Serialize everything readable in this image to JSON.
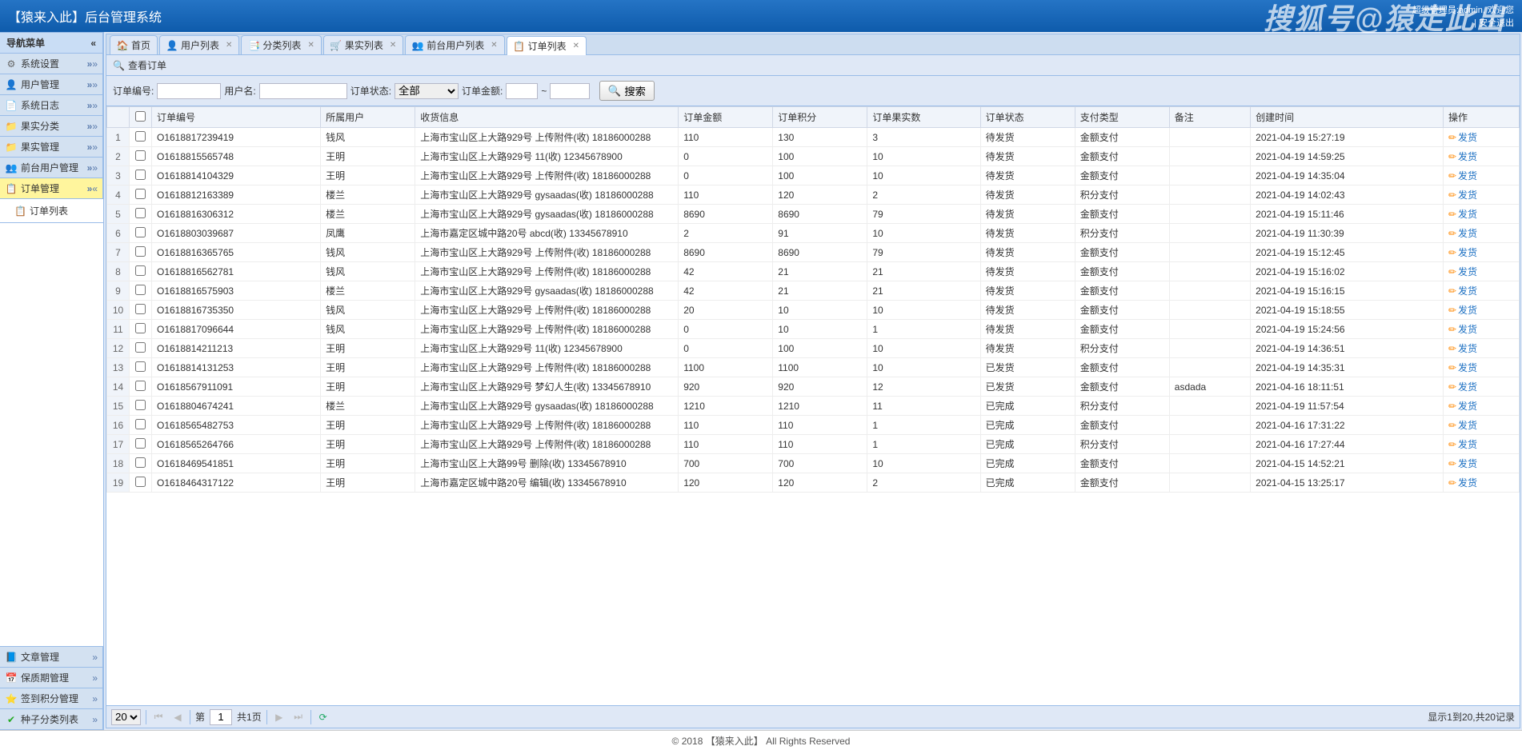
{
  "header": {
    "title": "【猿来入此】后台管理系统",
    "user_line": "超级管理员:admin, 欢迎您",
    "logout": "安全退出",
    "watermark": "搜狐号@猿走此出"
  },
  "sidebar": {
    "title": "导航菜单",
    "top_items": [
      {
        "label": "系统设置",
        "icon": "ico-gear"
      },
      {
        "label": "用户管理",
        "icon": "ico-user"
      },
      {
        "label": "系统日志",
        "icon": "ico-log"
      },
      {
        "label": "果实分类",
        "icon": "ico-folder"
      },
      {
        "label": "果实管理",
        "icon": "ico-folder"
      },
      {
        "label": "前台用户管理",
        "icon": "ico-users"
      },
      {
        "label": "订单管理",
        "icon": "ico-order",
        "active": true
      }
    ],
    "sub": {
      "label": "订单列表",
      "icon": "ico-order"
    },
    "bottom_items": [
      {
        "label": "文章管理",
        "icon": "ico-book"
      },
      {
        "label": "保质期管理",
        "icon": "ico-cal"
      },
      {
        "label": "签到积分管理",
        "icon": "ico-star"
      },
      {
        "label": "种子分类列表",
        "icon": "ico-seed"
      }
    ]
  },
  "tabs": [
    {
      "label": "首页",
      "icon": "ico-home",
      "closable": false
    },
    {
      "label": "用户列表",
      "icon": "ico-user",
      "closable": true
    },
    {
      "label": "分类列表",
      "icon": "ico-cat",
      "closable": true
    },
    {
      "label": "果实列表",
      "icon": "ico-fruit",
      "closable": true
    },
    {
      "label": "前台用户列表",
      "icon": "ico-users",
      "closable": true
    },
    {
      "label": "订单列表",
      "icon": "ico-order",
      "closable": true,
      "active": true
    }
  ],
  "panel_title": "查看订单",
  "search": {
    "order_no_label": "订单编号:",
    "user_label": "用户名:",
    "status_label": "订单状态:",
    "status_value": "全部",
    "amount_label": "订单金额:",
    "amount_sep": "~",
    "btn": "搜索"
  },
  "columns": [
    "",
    "",
    "订单编号",
    "所属用户",
    "收货信息",
    "订单金额",
    "订单积分",
    "订单果实数",
    "订单状态",
    "支付类型",
    "备注",
    "创建时间",
    "操作"
  ],
  "rows": [
    {
      "no": "O1618817239419",
      "user": "钱风",
      "addr": "上海市宝山区上大路929号 上传附件(收) 18186000288",
      "amount": "110",
      "points": "130",
      "qty": "3",
      "status": "待发货",
      "pay": "金额支付",
      "note": "",
      "time": "2021-04-19 15:27:19"
    },
    {
      "no": "O1618815565748",
      "user": "王明",
      "addr": "上海市宝山区上大路929号 11(收) 12345678900",
      "amount": "0",
      "points": "100",
      "qty": "10",
      "status": "待发货",
      "pay": "金额支付",
      "note": "",
      "time": "2021-04-19 14:59:25"
    },
    {
      "no": "O1618814104329",
      "user": "王明",
      "addr": "上海市宝山区上大路929号 上传附件(收) 18186000288",
      "amount": "0",
      "points": "100",
      "qty": "10",
      "status": "待发货",
      "pay": "金额支付",
      "note": "",
      "time": "2021-04-19 14:35:04"
    },
    {
      "no": "O1618812163389",
      "user": "楼兰",
      "addr": "上海市宝山区上大路929号 gysaadas(收) 18186000288",
      "amount": "110",
      "points": "120",
      "qty": "2",
      "status": "待发货",
      "pay": "积分支付",
      "note": "",
      "time": "2021-04-19 14:02:43"
    },
    {
      "no": "O1618816306312",
      "user": "楼兰",
      "addr": "上海市宝山区上大路929号 gysaadas(收) 18186000288",
      "amount": "8690",
      "points": "8690",
      "qty": "79",
      "status": "待发货",
      "pay": "金额支付",
      "note": "",
      "time": "2021-04-19 15:11:46"
    },
    {
      "no": "O1618803039687",
      "user": "凤鹰",
      "addr": "上海市嘉定区城中路20号 abcd(收) 13345678910",
      "amount": "2",
      "points": "91",
      "qty": "10",
      "status": "待发货",
      "pay": "积分支付",
      "note": "",
      "time": "2021-04-19 11:30:39"
    },
    {
      "no": "O1618816365765",
      "user": "钱风",
      "addr": "上海市宝山区上大路929号 上传附件(收) 18186000288",
      "amount": "8690",
      "points": "8690",
      "qty": "79",
      "status": "待发货",
      "pay": "金额支付",
      "note": "",
      "time": "2021-04-19 15:12:45"
    },
    {
      "no": "O1618816562781",
      "user": "钱风",
      "addr": "上海市宝山区上大路929号 上传附件(收) 18186000288",
      "amount": "42",
      "points": "21",
      "qty": "21",
      "status": "待发货",
      "pay": "金额支付",
      "note": "",
      "time": "2021-04-19 15:16:02"
    },
    {
      "no": "O1618816575903",
      "user": "楼兰",
      "addr": "上海市宝山区上大路929号 gysaadas(收) 18186000288",
      "amount": "42",
      "points": "21",
      "qty": "21",
      "status": "待发货",
      "pay": "金额支付",
      "note": "",
      "time": "2021-04-19 15:16:15"
    },
    {
      "no": "O1618816735350",
      "user": "钱风",
      "addr": "上海市宝山区上大路929号 上传附件(收) 18186000288",
      "amount": "20",
      "points": "10",
      "qty": "10",
      "status": "待发货",
      "pay": "金额支付",
      "note": "",
      "time": "2021-04-19 15:18:55"
    },
    {
      "no": "O1618817096644",
      "user": "钱风",
      "addr": "上海市宝山区上大路929号 上传附件(收) 18186000288",
      "amount": "0",
      "points": "10",
      "qty": "1",
      "status": "待发货",
      "pay": "金额支付",
      "note": "",
      "time": "2021-04-19 15:24:56"
    },
    {
      "no": "O1618814211213",
      "user": "王明",
      "addr": "上海市宝山区上大路929号 11(收) 12345678900",
      "amount": "0",
      "points": "100",
      "qty": "10",
      "status": "待发货",
      "pay": "积分支付",
      "note": "",
      "time": "2021-04-19 14:36:51"
    },
    {
      "no": "O1618814131253",
      "user": "王明",
      "addr": "上海市宝山区上大路929号 上传附件(收) 18186000288",
      "amount": "1100",
      "points": "1100",
      "qty": "10",
      "status": "已发货",
      "pay": "金额支付",
      "note": "",
      "time": "2021-04-19 14:35:31"
    },
    {
      "no": "O1618567911091",
      "user": "王明",
      "addr": "上海市宝山区上大路929号 梦幻人生(收) 13345678910",
      "amount": "920",
      "points": "920",
      "qty": "12",
      "status": "已发货",
      "pay": "金额支付",
      "note": "asdada",
      "time": "2021-04-16 18:11:51"
    },
    {
      "no": "O1618804674241",
      "user": "楼兰",
      "addr": "上海市宝山区上大路929号 gysaadas(收) 18186000288",
      "amount": "1210",
      "points": "1210",
      "qty": "11",
      "status": "已完成",
      "pay": "积分支付",
      "note": "",
      "time": "2021-04-19 11:57:54"
    },
    {
      "no": "O1618565482753",
      "user": "王明",
      "addr": "上海市宝山区上大路929号 上传附件(收) 18186000288",
      "amount": "110",
      "points": "110",
      "qty": "1",
      "status": "已完成",
      "pay": "金额支付",
      "note": "",
      "time": "2021-04-16 17:31:22"
    },
    {
      "no": "O1618565264766",
      "user": "王明",
      "addr": "上海市宝山区上大路929号 上传附件(收) 18186000288",
      "amount": "110",
      "points": "110",
      "qty": "1",
      "status": "已完成",
      "pay": "积分支付",
      "note": "",
      "time": "2021-04-16 17:27:44"
    },
    {
      "no": "O1618469541851",
      "user": "王明",
      "addr": "上海市宝山区上大路99号 删除(收) 13345678910",
      "amount": "700",
      "points": "700",
      "qty": "10",
      "status": "已完成",
      "pay": "金额支付",
      "note": "",
      "time": "2021-04-15 14:52:21"
    },
    {
      "no": "O1618464317122",
      "user": "王明",
      "addr": "上海市嘉定区城中路20号 编辑(收) 13345678910",
      "amount": "120",
      "points": "120",
      "qty": "2",
      "status": "已完成",
      "pay": "金额支付",
      "note": "",
      "time": "2021-04-15 13:25:17"
    }
  ],
  "action_label": "发货",
  "pager": {
    "size": "20",
    "page_label": "第",
    "page_value": "1",
    "total_pages": "共1页",
    "info": "显示1到20,共20记录"
  },
  "footer": "© 2018 【猿来入此】 All Rights Reserved"
}
